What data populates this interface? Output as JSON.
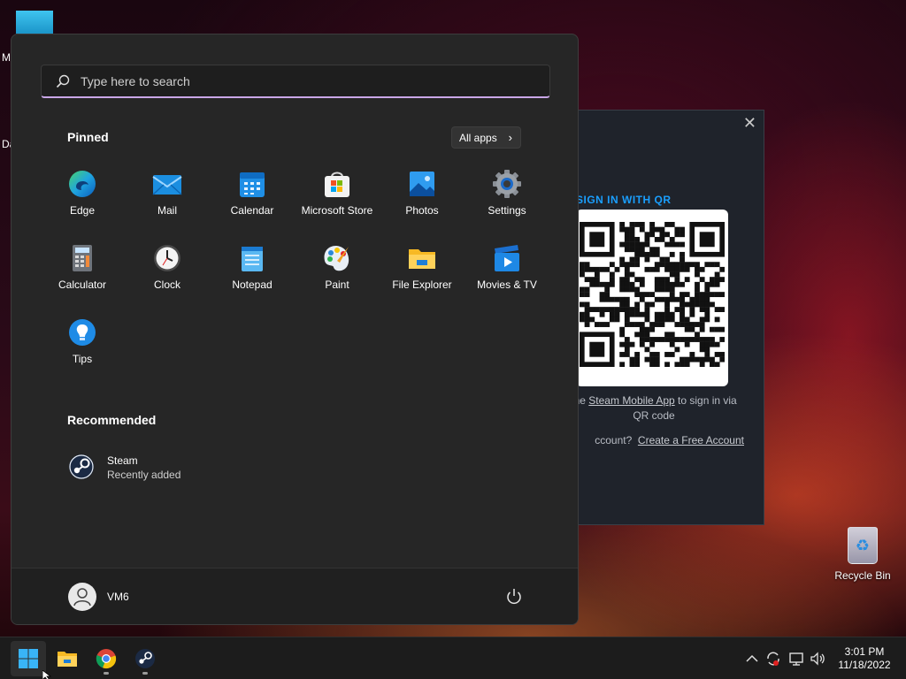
{
  "desktop": {
    "partial_label_1": "M",
    "partial_label_2": "Da",
    "recycle_bin_label": "Recycle Bin"
  },
  "steam_login": {
    "qr_title": "SIGN IN WITH QR",
    "hint_prefix": "the",
    "hint_link": "Steam Mobile App",
    "hint_suffix": "to sign in via QR code",
    "create_prefix": "ccount?",
    "create_link": "Create a Free Account",
    "accent_color": "#1a9fff"
  },
  "start_menu": {
    "search_placeholder": "Type here to search",
    "pinned_title": "Pinned",
    "all_apps_label": "All apps",
    "pinned_apps": [
      {
        "name": "Edge",
        "icon": "edge-icon"
      },
      {
        "name": "Mail",
        "icon": "mail-icon"
      },
      {
        "name": "Calendar",
        "icon": "calendar-icon"
      },
      {
        "name": "Microsoft Store",
        "icon": "store-icon"
      },
      {
        "name": "Photos",
        "icon": "photos-icon"
      },
      {
        "name": "Settings",
        "icon": "gear-icon"
      },
      {
        "name": "Calculator",
        "icon": "calculator-icon"
      },
      {
        "name": "Clock",
        "icon": "clock-icon"
      },
      {
        "name": "Notepad",
        "icon": "notepad-icon"
      },
      {
        "name": "Paint",
        "icon": "paint-icon"
      },
      {
        "name": "File Explorer",
        "icon": "folder-icon"
      },
      {
        "name": "Movies & TV",
        "icon": "movies-icon"
      },
      {
        "name": "Tips",
        "icon": "lightbulb-icon"
      }
    ],
    "recommended_title": "Recommended",
    "recommended": [
      {
        "name": "Steam",
        "detail": "Recently added",
        "icon": "steam-icon"
      }
    ],
    "user_name": "VM6"
  },
  "taskbar": {
    "apps": [
      "start-icon",
      "folder-icon",
      "chrome-icon",
      "steam-icon"
    ],
    "time": "3:01 PM",
    "date": "11/18/2022"
  }
}
